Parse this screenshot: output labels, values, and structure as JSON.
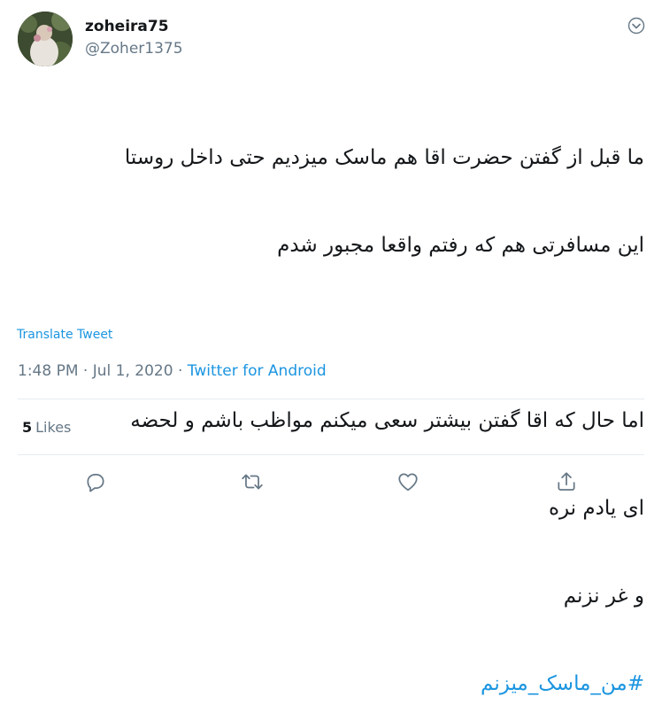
{
  "author": {
    "display_name": "zoheira75",
    "handle": "@Zoher1375"
  },
  "tweet": {
    "lines": [
      "ما قبل از گفتن حضرت اقا هم ماسک میزدیم حتی داخل روستا",
      "این مسافرتی هم که رفتم واقعا مجبور شدم",
      "",
      "اما حال که اقا گفتن بیشتر سعی میکنم مواظب باشم و لحضه",
      "ای یادم نره",
      "و غر نزنم"
    ],
    "hashtag": "#من_ماسک_میزنم",
    "translate_label": "Translate Tweet"
  },
  "meta": {
    "time": "1:48 PM",
    "separator": "·",
    "date": "Jul 1, 2020",
    "source": "Twitter for Android"
  },
  "stats": {
    "likes_count": "5",
    "likes_label": "Likes"
  },
  "icons": {
    "menu": "chevron-down-icon",
    "reply": "reply-icon",
    "retweet": "retweet-icon",
    "like": "heart-icon",
    "share": "share-icon"
  },
  "colors": {
    "link": "#1b95e0",
    "secondary_text": "#657786",
    "icon": "#657786"
  }
}
